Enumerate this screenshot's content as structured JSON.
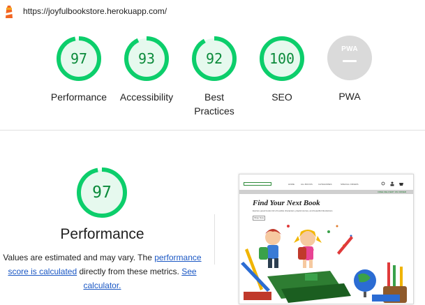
{
  "header": {
    "url": "https://joyfulbookstore.herokuapp.com/",
    "logo_icon": "lighthouse-icon"
  },
  "categories": [
    {
      "name": "Performance",
      "score": 97,
      "score_label": "97"
    },
    {
      "name": "Accessibility",
      "score": 93,
      "score_label": "93"
    },
    {
      "name": "Best Practices",
      "score": 92,
      "score_label": "92"
    },
    {
      "name": "SEO",
      "score": 100,
      "score_label": "100"
    },
    {
      "name": "PWA",
      "score": null,
      "badge": "PWA"
    }
  ],
  "performance": {
    "score": 97,
    "score_label": "97",
    "title": "Performance",
    "desc_part1": "Values are estimated and may vary. The ",
    "desc_link1": "performance score is calculated",
    "desc_part2": " directly from these metrics. ",
    "desc_link2": "See calculator.",
    "desc_end": ""
  },
  "thumbnail": {
    "nav_links": [
      "HOME",
      "ALL BOOKS",
      "CATEGORIES",
      "SPECIAL OFFERS"
    ],
    "free_delivery": "FREE DELIVERY ON ORDER",
    "hero_title": "Find Your Next Book",
    "hero_subtitle": "Explore great books full of lovable characters, playful stories, and beautiful illustrations",
    "hero_button": "Shop Now"
  },
  "colors": {
    "pass_green": "#0cce6b",
    "pass_fill": "#e6f9ee",
    "pass_text": "#0a8a3a",
    "link_blue": "#1a57c4",
    "na_gray": "#dadada"
  }
}
